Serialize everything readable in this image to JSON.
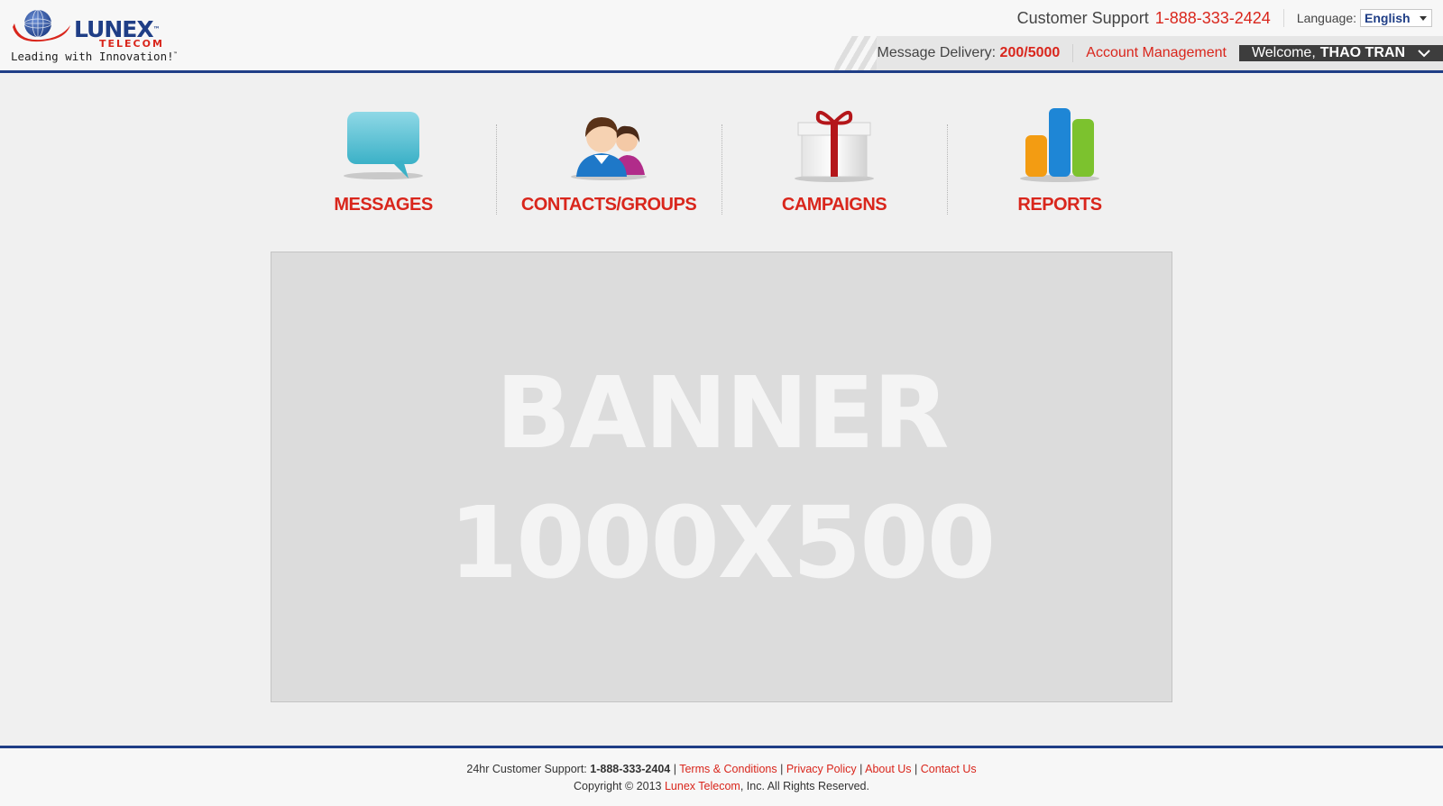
{
  "logo": {
    "brand": "LUNEX",
    "sub": "TELECOM",
    "tagline": "Leading with Innovation!",
    "trademark": "™"
  },
  "header": {
    "support_label": "Customer Support",
    "support_phone": "1-888-333-2424",
    "language_label": "Language:",
    "language_value": "English",
    "delivery_label": "Message Delivery:",
    "delivery_count": "200/5000",
    "account_label": "Account Management",
    "welcome_label": "Welcome,",
    "user_name": "THAO TRAN"
  },
  "nav": {
    "items": [
      {
        "label": "MESSAGES",
        "icon": "speech-bubble-icon"
      },
      {
        "label": "CONTACTS/GROUPS",
        "icon": "contacts-icon"
      },
      {
        "label": "CAMPAIGNS",
        "icon": "gift-box-icon"
      },
      {
        "label": "REPORTS",
        "icon": "bar-chart-icon"
      }
    ]
  },
  "banner": {
    "line1": "BANNER",
    "line2": "1000X500"
  },
  "footer": {
    "support_prefix": "24hr Customer Support:",
    "support_phone": "1-888-333-2404",
    "sep": "|",
    "terms": "Terms & Conditions",
    "privacy": "Privacy Policy",
    "about": "About Us",
    "contact": "Contact Us",
    "copyright_prefix": "Copyright © 2013",
    "company": "Lunex Telecom",
    "copyright_suffix": ", Inc. All Rights Reserved."
  },
  "colors": {
    "accent_red": "#d9261c",
    "brand_blue": "#1f3e86",
    "dark_bar": "#3d3d3d"
  }
}
